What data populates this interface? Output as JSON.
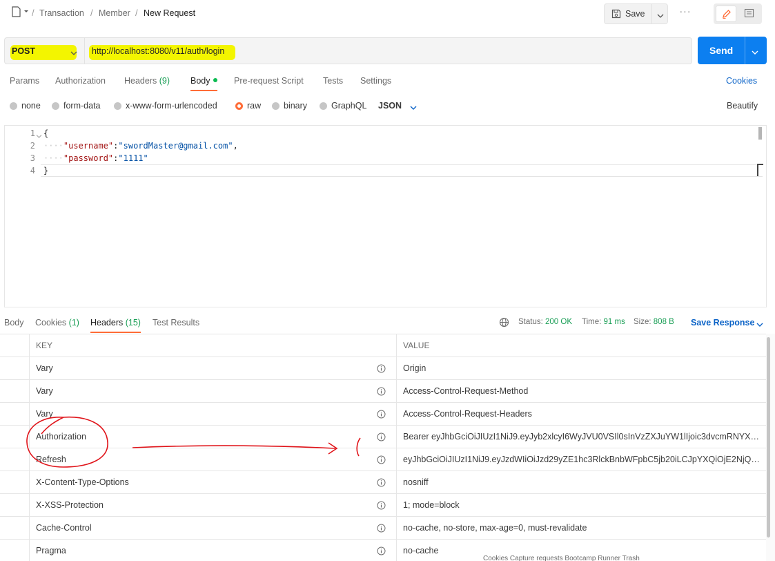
{
  "breadcrumb": {
    "items": [
      "Transaction",
      "Member"
    ],
    "current": "New Request"
  },
  "toolbar": {
    "save_label": "Save",
    "more_label": "···"
  },
  "request": {
    "method": "POST",
    "url": "http://localhost:8080/v11/auth/login",
    "send_label": "Send"
  },
  "request_tabs": {
    "params": "Params",
    "authorization": "Authorization",
    "headers": "Headers",
    "headers_count": "(9)",
    "body": "Body",
    "prerequest": "Pre-request Script",
    "tests": "Tests",
    "settings": "Settings",
    "cookies": "Cookies"
  },
  "body_types": {
    "none": "none",
    "form_data": "form-data",
    "urlencoded": "x-www-form-urlencoded",
    "raw": "raw",
    "binary": "binary",
    "graphql": "GraphQL",
    "format": "JSON",
    "beautify": "Beautify"
  },
  "editor": {
    "line_numbers": [
      "1",
      "2",
      "3",
      "4"
    ],
    "open_brace": "{",
    "close_brace": "}",
    "indent": "····",
    "line2_key": "\"username\"",
    "line2_value": "\"swordMaster@gmail.com\"",
    "line3_key": "\"password\"",
    "line3_value": "\"1111\"",
    "colon": ":",
    "comma": ","
  },
  "response_tabs": {
    "body": "Body",
    "cookies": "Cookies",
    "cookies_count": "(1)",
    "headers": "Headers",
    "headers_count": "(15)",
    "test_results": "Test Results"
  },
  "response_meta": {
    "status_label": "Status:",
    "status_value": "200 OK",
    "time_label": "Time:",
    "time_value": "91 ms",
    "size_label": "Size:",
    "size_value": "808 B",
    "save_response": "Save Response"
  },
  "headers_table": {
    "key_header": "KEY",
    "value_header": "VALUE",
    "rows": [
      {
        "key": "Vary",
        "value": "Origin"
      },
      {
        "key": "Vary",
        "value": "Access-Control-Request-Method"
      },
      {
        "key": "Vary",
        "value": "Access-Control-Request-Headers"
      },
      {
        "key": "Authorization",
        "value": "Bearer eyJhbGciOiJIUzI1NiJ9.eyJyb2xlcyI6WyJVU0VSIl0sInVzZXJuYW1lIjoic3dvcmRNYXN..."
      },
      {
        "key": "Refresh",
        "value": "eyJhbGciOiJIUzI1NiJ9.eyJzdWIiOiJzd29yZE1hc3RlckBnbWFpbC5jb20iLCJpYXQiOjE2NjQy..."
      },
      {
        "key": "X-Content-Type-Options",
        "value": "nosniff"
      },
      {
        "key": "X-XSS-Protection",
        "value": "1; mode=block"
      },
      {
        "key": "Cache-Control",
        "value": "no-cache, no-store, max-age=0, must-revalidate"
      },
      {
        "key": "Pragma",
        "value": "no-cache"
      }
    ]
  },
  "footer": {
    "text": "Cookies   Capture requests   Bootcamp   Runner   Trash"
  },
  "colors": {
    "accent": "#ff6c37",
    "send": "#0c7ff0",
    "link": "#0b63c7",
    "success": "#199e55",
    "highlight": "#f3f500",
    "annotation": "#e0141a"
  }
}
